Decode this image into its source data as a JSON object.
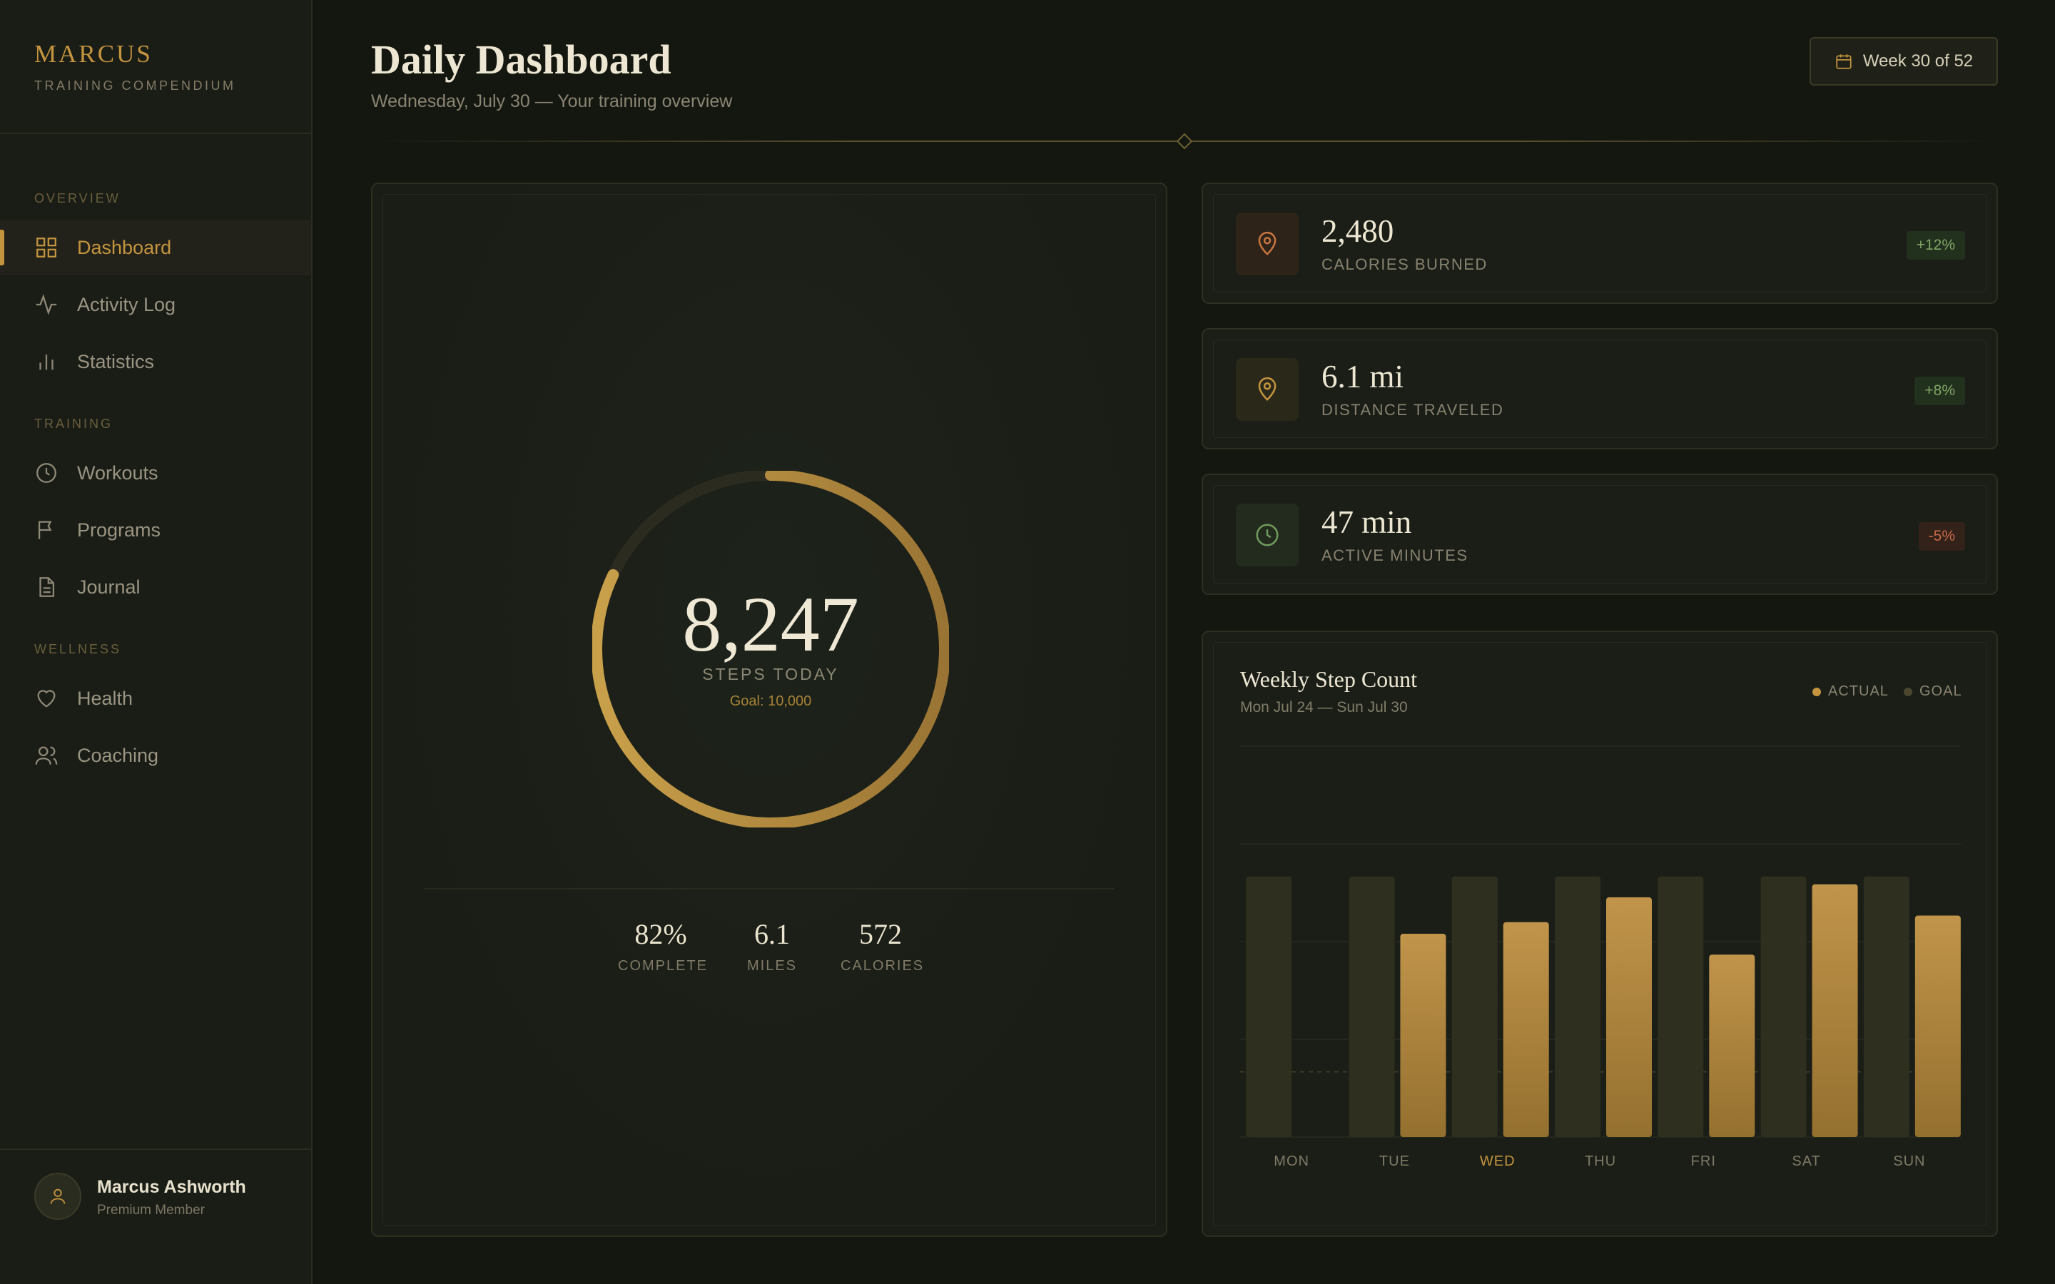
{
  "brand": {
    "name": "MARCUS",
    "subtitle": "TRAINING COMPENDIUM"
  },
  "sidebar": {
    "sections": [
      {
        "title": "OVERVIEW",
        "items": [
          {
            "label": "Dashboard",
            "icon": "grid-icon",
            "active": true
          },
          {
            "label": "Activity Log",
            "icon": "pulse-icon"
          },
          {
            "label": "Statistics",
            "icon": "bar-chart-icon"
          }
        ]
      },
      {
        "title": "TRAINING",
        "items": [
          {
            "label": "Workouts",
            "icon": "clock-icon"
          },
          {
            "label": "Programs",
            "icon": "flag-icon"
          },
          {
            "label": "Journal",
            "icon": "document-icon"
          }
        ]
      },
      {
        "title": "WELLNESS",
        "items": [
          {
            "label": "Health",
            "icon": "heart-icon"
          },
          {
            "label": "Coaching",
            "icon": "users-icon"
          }
        ]
      }
    ]
  },
  "profile": {
    "name": "Marcus Ashworth",
    "role": "Premium Member"
  },
  "header": {
    "title": "Daily Dashboard",
    "subtitle": "Wednesday, July 30 — Your training overview",
    "week": "Week 30 of 52"
  },
  "steps": {
    "value": "8,247",
    "label": "STEPS TODAY",
    "goal": "Goal: 10,000",
    "progress": 0.82,
    "stats": [
      {
        "value": "82%",
        "label": "COMPLETE"
      },
      {
        "value": "6.1",
        "label": "MILES"
      },
      {
        "value": "572",
        "label": "CALORIES"
      }
    ]
  },
  "metrics": [
    {
      "value": "2,480",
      "label": "CALORIES BURNED",
      "change": "+12%",
      "trend": "up",
      "icon": "map-pin-icon",
      "color": "#c9753f",
      "bg": "#2e2319"
    },
    {
      "value": "6.1 mi",
      "label": "DISTANCE TRAVELED",
      "change": "+8%",
      "trend": "up",
      "icon": "map-pin-icon",
      "color": "#c4943e",
      "bg": "#2a2819"
    },
    {
      "value": "47 min",
      "label": "ACTIVE MINUTES",
      "change": "-5%",
      "trend": "down",
      "icon": "clock-icon",
      "color": "#6f9a5c",
      "bg": "#232b1e"
    }
  ],
  "colors": {
    "accent": "#c4943e",
    "goal_bar": "#2f2f1f",
    "up": "#7fa564",
    "down": "#c76a45"
  },
  "chart": {
    "title": "Weekly Step Count",
    "subtitle": "Mon Jul 24 — Sun Jul 30",
    "legend": {
      "actual": "ACTUAL",
      "goal": "GOAL"
    }
  },
  "chart_data": {
    "type": "bar",
    "title": "Weekly Step Count",
    "categories": [
      "MON",
      "TUE",
      "WED",
      "THU",
      "FRI",
      "SAT",
      "SUN"
    ],
    "highlight": "WED",
    "ylim": [
      0,
      15000
    ],
    "grid": true,
    "legend_position": "top-right",
    "series": [
      {
        "name": "GOAL",
        "values": [
          10000,
          10000,
          10000,
          10000,
          10000,
          10000,
          10000
        ]
      },
      {
        "name": "ACTUAL",
        "values": [
          null,
          7800,
          8247,
          9200,
          7000,
          9700,
          8500
        ]
      }
    ]
  }
}
